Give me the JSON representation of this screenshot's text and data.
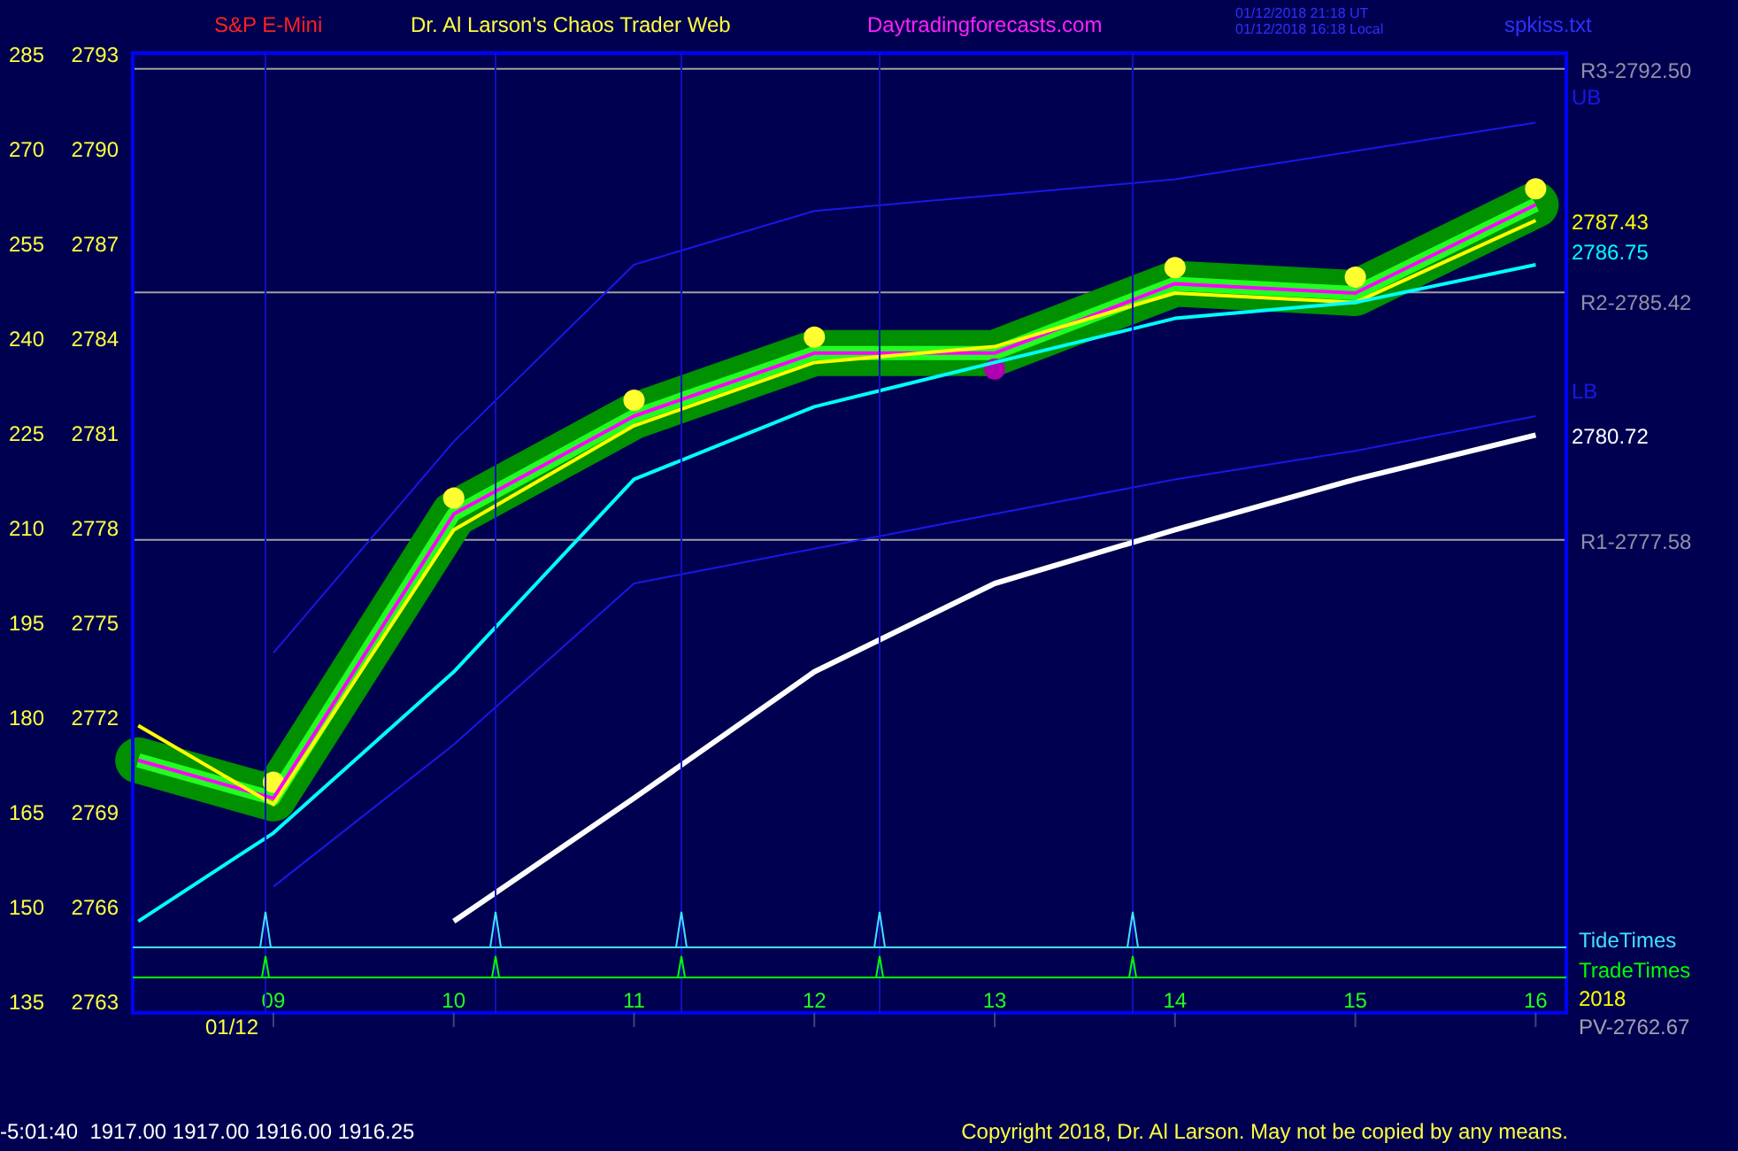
{
  "header": {
    "symbol": "S&P E-Mini",
    "title": "Dr. Al Larson's Chaos Trader Web",
    "site": "Daytradingforecasts.com",
    "time_ut": "01/12/2018 21:18 UT",
    "time_local": "01/12/2018 16:18 Local",
    "file": "spkiss.txt"
  },
  "left_scale": [
    "285",
    "270",
    "255",
    "240",
    "225",
    "210",
    "195",
    "180",
    "165",
    "150",
    "135"
  ],
  "chart_data": {
    "type": "line",
    "x": [
      8.25,
      9,
      10,
      11,
      12,
      13,
      14,
      15,
      16
    ],
    "series": [
      {
        "color": "#ff00ff",
        "values": [
          2770.6,
          2769.4,
          2778.4,
          2781.5,
          2783.5,
          2783.5,
          2785.7,
          2785.4,
          2788.2
        ]
      },
      {
        "color": "#ffff00",
        "values": [
          2771.7,
          2769.2,
          2777.9,
          2781.2,
          2783.2,
          2783.7,
          2785.4,
          2785.1,
          2787.7
        ]
      },
      {
        "color": "#00ffff",
        "values": [
          2765.5,
          2768.3,
          2773.4,
          2779.5,
          2781.8,
          2783.2,
          2784.6,
          2785.1,
          2786.3
        ]
      },
      {
        "color": "#ffffff",
        "values": [
          null,
          null,
          2765.5,
          2769.4,
          2773.4,
          2776.2,
          2777.9,
          2779.5,
          2780.9
        ]
      },
      {
        "color": "#1818e8",
        "values": [
          null,
          2774.0,
          2780.7,
          2786.3,
          2788.0,
          2788.5,
          2789.0,
          2789.9,
          2790.8
        ]
      },
      {
        "color": "#1818e8",
        "values": [
          null,
          2766.6,
          2771.1,
          2776.2,
          2777.3,
          2778.4,
          2779.5,
          2780.4,
          2781.5
        ]
      }
    ],
    "xlim": [
      8.22,
      16.17
    ],
    "ylim": [
      2762.6,
      2793
    ],
    "xticks": [
      {
        "value": 9,
        "label": "09"
      },
      {
        "value": 10,
        "label": "10"
      },
      {
        "value": 11,
        "label": "11"
      },
      {
        "value": 12,
        "label": "12"
      },
      {
        "value": 13,
        "label": "13"
      },
      {
        "value": 14,
        "label": "14"
      },
      {
        "value": 15,
        "label": "15"
      },
      {
        "value": 16,
        "label": "16"
      }
    ],
    "yticks": [
      {
        "value": 2793,
        "label": "2793"
      },
      {
        "value": 2790,
        "label": "2790"
      },
      {
        "value": 2787,
        "label": "2787"
      },
      {
        "value": 2784,
        "label": "2784"
      },
      {
        "value": 2781,
        "label": "2781"
      },
      {
        "value": 2778,
        "label": "2778"
      },
      {
        "value": 2775,
        "label": "2775"
      },
      {
        "value": 2772,
        "label": "2772"
      },
      {
        "value": 2769,
        "label": "2769"
      },
      {
        "value": 2766,
        "label": "2766"
      },
      {
        "value": 2763,
        "label": "2763"
      }
    ]
  },
  "level_labels": [
    "R3-2792.50",
    "R2-2785.42",
    "R1-2777.58"
  ],
  "end_labels": [
    {
      "text": "UB",
      "color": "#1818e8"
    },
    {
      "text": "2787.43",
      "color": "#ffff00"
    },
    {
      "text": "2786.75",
      "color": "#00ffff"
    },
    {
      "text": "LB",
      "color": "#1818e8"
    },
    {
      "text": "2780.72",
      "color": "#ffffff"
    }
  ],
  "date_label": "01/12",
  "bottom_labels": [
    {
      "text": "TideTimes",
      "color": "#40e0ff"
    },
    {
      "text": "TradeTimes",
      "color": "#00ff00"
    },
    {
      "text": "2018",
      "color": "#ffff00"
    },
    {
      "text": "PV-2762.67",
      "color": "#a0a0b0"
    }
  ],
  "footer": {
    "quote": "-5:01:40  1917.00 1917.00 1916.00 1916.25",
    "copyright": "Copyright 2018, Dr. Al Larson. May not be copied by any means."
  }
}
